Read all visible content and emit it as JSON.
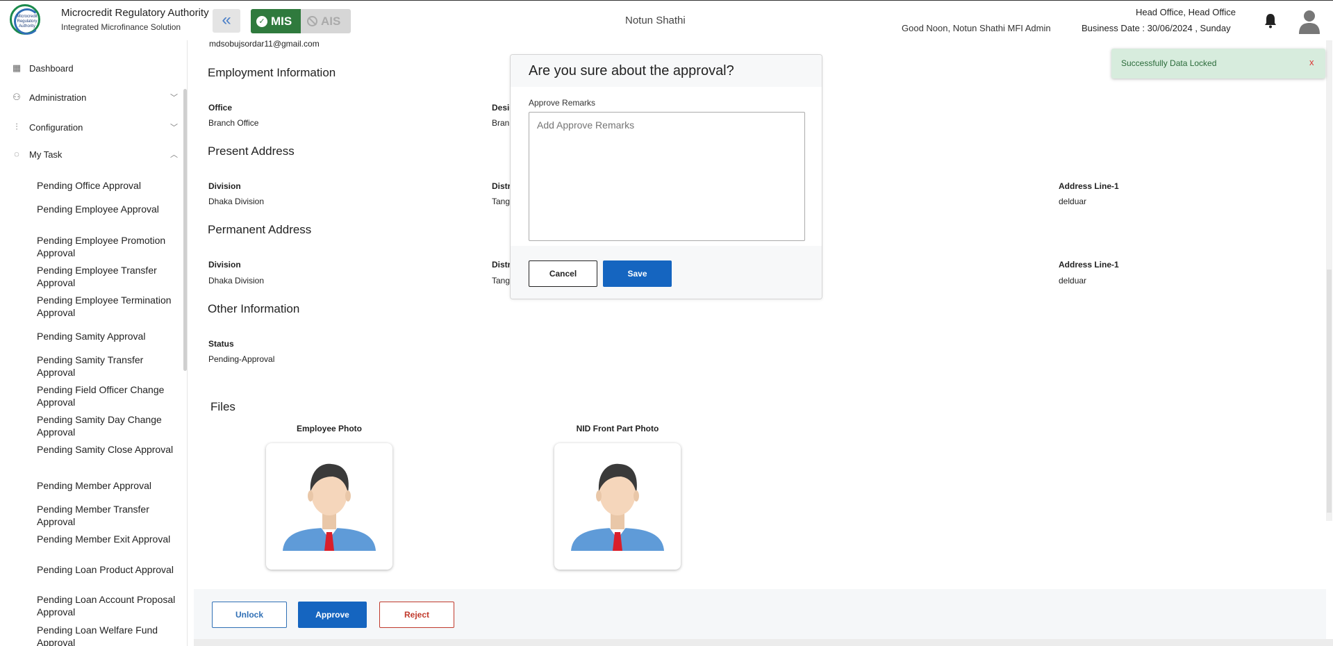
{
  "header": {
    "logo_text": "Microcredit Regulatory Authority",
    "org_title": "Microcredit Regulatory Authority",
    "org_subtitle": "Integrated Microfinance Solution",
    "collapse_icon": "«",
    "mis_label": "MIS",
    "ais_label": "AIS",
    "center_title": "Notun Shathi",
    "greeting": "Good Noon, Notun Shathi MFI Admin",
    "office": "Head Office, Head Office",
    "business_date": "Business Date : 30/06/2024 , Sunday"
  },
  "sidebar": {
    "nav": [
      {
        "label": "Dashboard",
        "icon": "grid-icon"
      },
      {
        "label": "Administration",
        "icon": "users-icon"
      },
      {
        "label": "Configuration",
        "icon": "sliders-icon"
      },
      {
        "label": "My Task",
        "icon": "task-icon"
      }
    ],
    "tasks": [
      "Pending Office Approval",
      "Pending Employee Approval",
      "Pending Employee Promotion Approval",
      "Pending Employee Transfer Approval",
      "Pending Employee Termination Approval",
      "Pending Samity Approval",
      "Pending Samity Transfer Approval",
      "Pending Field Officer Change Approval",
      "Pending Samity Day Change Approval",
      "Pending Samity Close Approval",
      "Pending Member Approval",
      "Pending Member Transfer Approval",
      "Pending Member Exit Approval",
      "Pending Loan Product Approval",
      "Pending Loan Account Proposal Approval",
      "Pending Loan Welfare Fund Approval"
    ]
  },
  "details": {
    "email": "mdsobujsordar11@gmail.com",
    "employment": {
      "title": "Employment Information",
      "office_label": "Office",
      "office_value": "Branch Office",
      "designation_label": "Desig",
      "designation_value": "Bran"
    },
    "present": {
      "title": "Present Address",
      "division_label": "Division",
      "division_value": "Dhaka Division",
      "district_label": "Distr",
      "district_value": "Tang",
      "address_label": "Address Line-1",
      "address_value": "delduar"
    },
    "permanent": {
      "title": "Permanent Address",
      "division_label": "Division",
      "division_value": "Dhaka Division",
      "district_label": "Distr",
      "district_value": "Tang",
      "address_label": "Address Line-1",
      "address_value": "delduar"
    },
    "other": {
      "title": "Other Information",
      "status_label": "Status",
      "status_value": "Pending-Approval"
    },
    "files": {
      "title": "Files",
      "employee_photo_label": "Employee Photo",
      "nid_photo_label": "NID Front Part Photo"
    }
  },
  "actions": {
    "unlock": "Unlock",
    "approve": "Approve",
    "reject": "Reject"
  },
  "modal": {
    "title": "Are you sure about the approval?",
    "remarks_label": "Approve Remarks",
    "remarks_placeholder": "Add Approve Remarks",
    "cancel": "Cancel",
    "save": "Save"
  },
  "toast": {
    "message": "Successfully Data Locked",
    "close": "x"
  },
  "colors": {
    "mis_green": "#2f7a3d",
    "primary_blue": "#1565c0",
    "reject_red": "#c0392b",
    "toast_bg": "#d7ecdd"
  }
}
